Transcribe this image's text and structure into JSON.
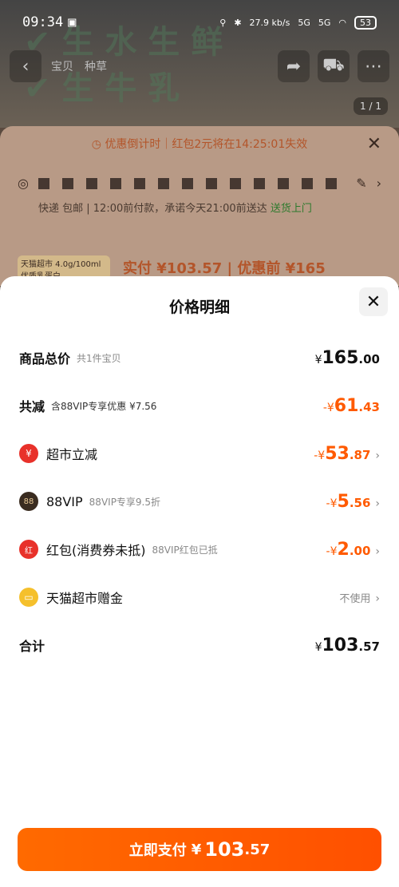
{
  "status": {
    "time": "09:34",
    "net_speed": "27.9",
    "net_unit": "kb/s",
    "sig1": "5G",
    "sig2": "5G",
    "battery": "53"
  },
  "background": {
    "nav_tab1": "宝贝",
    "nav_tab2": "种草",
    "page_indicator": "1 / 1",
    "countdown": "优惠倒计时｜红包2元将在14:25:01失效",
    "delivery_text": "快递 包邮 | 12:00前付款，承诺今天21:00前送达 ",
    "delivery_highlight": "送货上门",
    "product_thumb_text": "天猫超市 4.0g/100ml优质乳蛋白",
    "product_price": "实付 ¥103.57 | 优惠前 ¥165"
  },
  "modal": {
    "title": "价格明细",
    "rows": {
      "total": {
        "label": "商品总价",
        "sub": "共1件宝贝",
        "currency": "¥",
        "int": "165",
        "dec": ".00"
      },
      "discount": {
        "label": "共减",
        "sub": "含88VIP专享优惠 ¥7.56",
        "sign": "-¥",
        "int": "61",
        "dec": ".43"
      },
      "supermarket": {
        "label": "超市立减",
        "icon": "¥",
        "sign": "-¥",
        "int": "53",
        "dec": ".87"
      },
      "vip": {
        "label": "88VIP",
        "sub": "88VIP专享9.5折",
        "icon": "88",
        "sign": "-¥",
        "int": "5",
        "dec": ".56"
      },
      "redpacket": {
        "label": "红包(消费券未抵)",
        "sub": "88VIP红包已抵",
        "icon": "红",
        "sign": "-¥",
        "int": "2",
        "dec": ".00"
      },
      "gift": {
        "label": "天猫超市赠金",
        "value": "不使用"
      },
      "sum": {
        "label": "合计",
        "currency": "¥",
        "int": "103",
        "dec": ".57"
      }
    },
    "pay_button": {
      "label": "立即支付",
      "currency": "¥",
      "int": "103",
      "dec": ".57"
    }
  },
  "colors": {
    "accent": "#ff5a00",
    "modal_bg": "#ffffff"
  }
}
